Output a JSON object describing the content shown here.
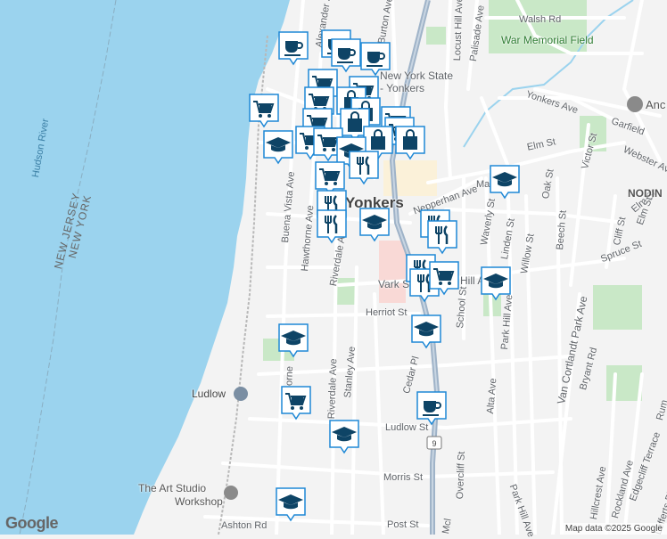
{
  "labels": {
    "alexander": "Alexander St",
    "burton": "Burton Ave",
    "locust": "Locust Hill Ave",
    "palisade": "Palisade Ave",
    "walsh": "Walsh Rd",
    "war_memorial": "War Memorial Field",
    "nys_yonkers_1": "New York State",
    "nys_yonkers_2": "- Yonkers",
    "yonkers_ave": "Yonkers Ave",
    "garfield": "Garfield",
    "webster": "Webster Ave",
    "victor": "Victor St",
    "elm1": "Elm St",
    "elm2": "Elm St",
    "nodin": "NODIN",
    "oak": "Oak St",
    "nepperhan": "Nepperhan Ave",
    "yonkers": "Yonkers",
    "hudson": "Hudson River",
    "nj": "NEW JERSEY",
    "ny": "NEW YORK",
    "buena": "Buena Vista Ave",
    "hawthorne": "Hawthorne Ave",
    "riverdale1": "Riverdale Ave",
    "riverdale2": "Riverdale Ave",
    "waverly": "Waverly St",
    "linden": "Linden St",
    "willow": "Willow St",
    "beech": "Beech St",
    "cliff": "Cliff St",
    "elm3": "Elm St",
    "spruce": "Spruce St",
    "vark": "Vark St",
    "hill": "Hill A",
    "school": "School St",
    "park_hill_ave1": "Park Hill Ave",
    "park_hill_ave2": "Park Hill Ave",
    "van_cortlandt": "Van Cortlandt Park Ave",
    "herriot": "Herriot St",
    "stanley": "Stanley Ave",
    "cedar": "Cedar Pl",
    "thorne": "thorne",
    "alta": "Alta Ave",
    "bryant": "Bryant Rd",
    "ludlow_station": "Ludlow",
    "ludlow_st": "Ludlow St",
    "overcliff": "Overcliff St",
    "hillcrest": "Hillcrest Ave",
    "rockland": "Rockland Ave",
    "edgecliff": "Edgecliff Terrace",
    "rum": "Rum",
    "lefferts": "Lefferts Pl",
    "morris": "Morris St",
    "ashton": "Ashton Rd",
    "post": "Post St",
    "mcl": "Mcl",
    "art_studio_1": "The Art Studio",
    "art_studio_2": "Workshop",
    "anc": "Anc",
    "route9": "9",
    "ma": "Ma"
  },
  "icons": {
    "cafe": "coffee-cup-icon",
    "shop": "shopping-cart-icon",
    "bag": "shopping-bag-icon",
    "food": "fork-knife-icon",
    "school": "graduation-cap-icon"
  },
  "colors": {
    "water": "#9bd3ee",
    "land": "#f3f3f3",
    "park": "#c9e8c7",
    "marker": "#ffffff",
    "marker_border": "#1e88d6",
    "marker_glyph": "#0e4466",
    "highway": "#9fb3c8"
  },
  "branding": {
    "google": "Google",
    "attribution": "Map data ©2025 Google"
  }
}
